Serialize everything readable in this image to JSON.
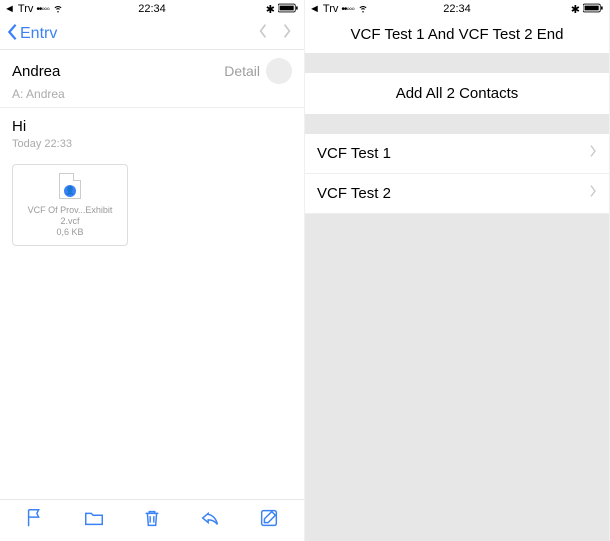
{
  "status": {
    "back_indicator": "◄",
    "carrier": "Trv",
    "dots": "••◦◦◦",
    "time": "22:34",
    "bt": "⚡",
    "bt2": "✱"
  },
  "left": {
    "nav_back_label": "Entrv",
    "sender": "Andrea",
    "to_line": "A: Andrea",
    "detail_label": "Detail",
    "subject": "Hi",
    "timestamp": "Today 22:33",
    "attachment": {
      "name": "VCF Of Prov...Exhibit 2.vcf",
      "size": "0,6 KB"
    }
  },
  "right": {
    "title": "VCF Test 1 And VCF Test 2 End",
    "add_all_label": "Add All 2 Contacts",
    "contacts": [
      "VCF Test 1",
      "VCF Test 2"
    ]
  }
}
